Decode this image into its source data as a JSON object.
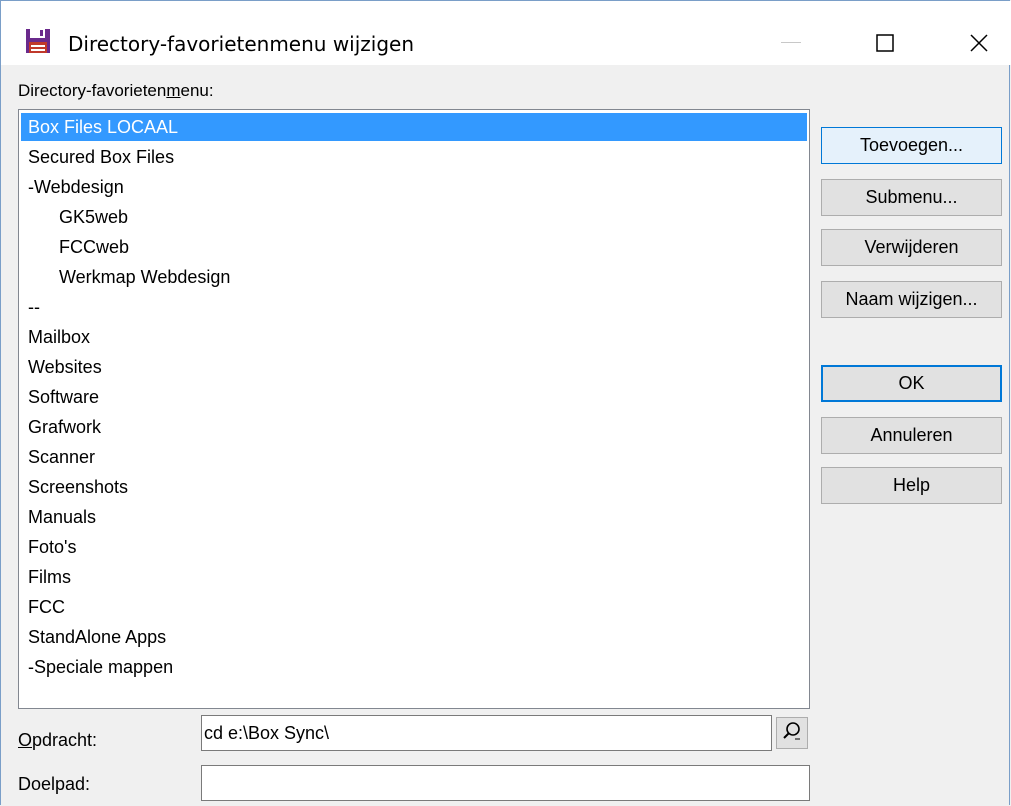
{
  "window": {
    "title": "Directory-favorietenmenu wijzigen",
    "controls": {
      "minimize": "minimize-icon",
      "maximize": "maximize-icon",
      "close": "close-icon"
    },
    "icon": "floppy-disk-icon"
  },
  "list": {
    "label_before": "Directory-favorieten",
    "label_hotkey": "m",
    "label_after": "enu:",
    "items": [
      {
        "label": "Box Files LOCAAL",
        "indent": false,
        "selected": true
      },
      {
        "label": "Secured Box Files",
        "indent": false,
        "selected": false
      },
      {
        "label": "-Webdesign",
        "indent": false,
        "selected": false
      },
      {
        "label": "GK5web",
        "indent": true,
        "selected": false
      },
      {
        "label": "FCCweb",
        "indent": true,
        "selected": false
      },
      {
        "label": "Werkmap Webdesign",
        "indent": true,
        "selected": false
      },
      {
        "label": "--",
        "indent": false,
        "selected": false
      },
      {
        "label": "Mailbox",
        "indent": false,
        "selected": false
      },
      {
        "label": "Websites",
        "indent": false,
        "selected": false
      },
      {
        "label": "Software",
        "indent": false,
        "selected": false
      },
      {
        "label": "Grafwork",
        "indent": false,
        "selected": false
      },
      {
        "label": "Scanner",
        "indent": false,
        "selected": false
      },
      {
        "label": "Screenshots",
        "indent": false,
        "selected": false
      },
      {
        "label": "Manuals",
        "indent": false,
        "selected": false
      },
      {
        "label": "Foto's",
        "indent": false,
        "selected": false
      },
      {
        "label": "Films",
        "indent": false,
        "selected": false
      },
      {
        "label": "FCC",
        "indent": false,
        "selected": false
      },
      {
        "label": "StandAlone Apps",
        "indent": false,
        "selected": false
      },
      {
        "label": "-Speciale mappen",
        "indent": false,
        "selected": false
      }
    ]
  },
  "buttons": {
    "add": "Toevoegen...",
    "submenu": "Submenu...",
    "delete": "Verwijderen",
    "rename": "Naam wijzigen...",
    "ok": "OK",
    "cancel": "Annuleren",
    "help": "Help"
  },
  "fields": {
    "command_label_hotkey": "O",
    "command_label_rest": "pdracht:",
    "command_value": "cd e:\\Box Sync\\",
    "target_label": "Doelpad:",
    "target_value": "",
    "browse_icon": "magnifier-icon"
  },
  "colors": {
    "selection": "#3399ff",
    "focus_border": "#0078d7",
    "focus_bg": "#e5f1fb",
    "window_bg": "#f0f0f0"
  }
}
